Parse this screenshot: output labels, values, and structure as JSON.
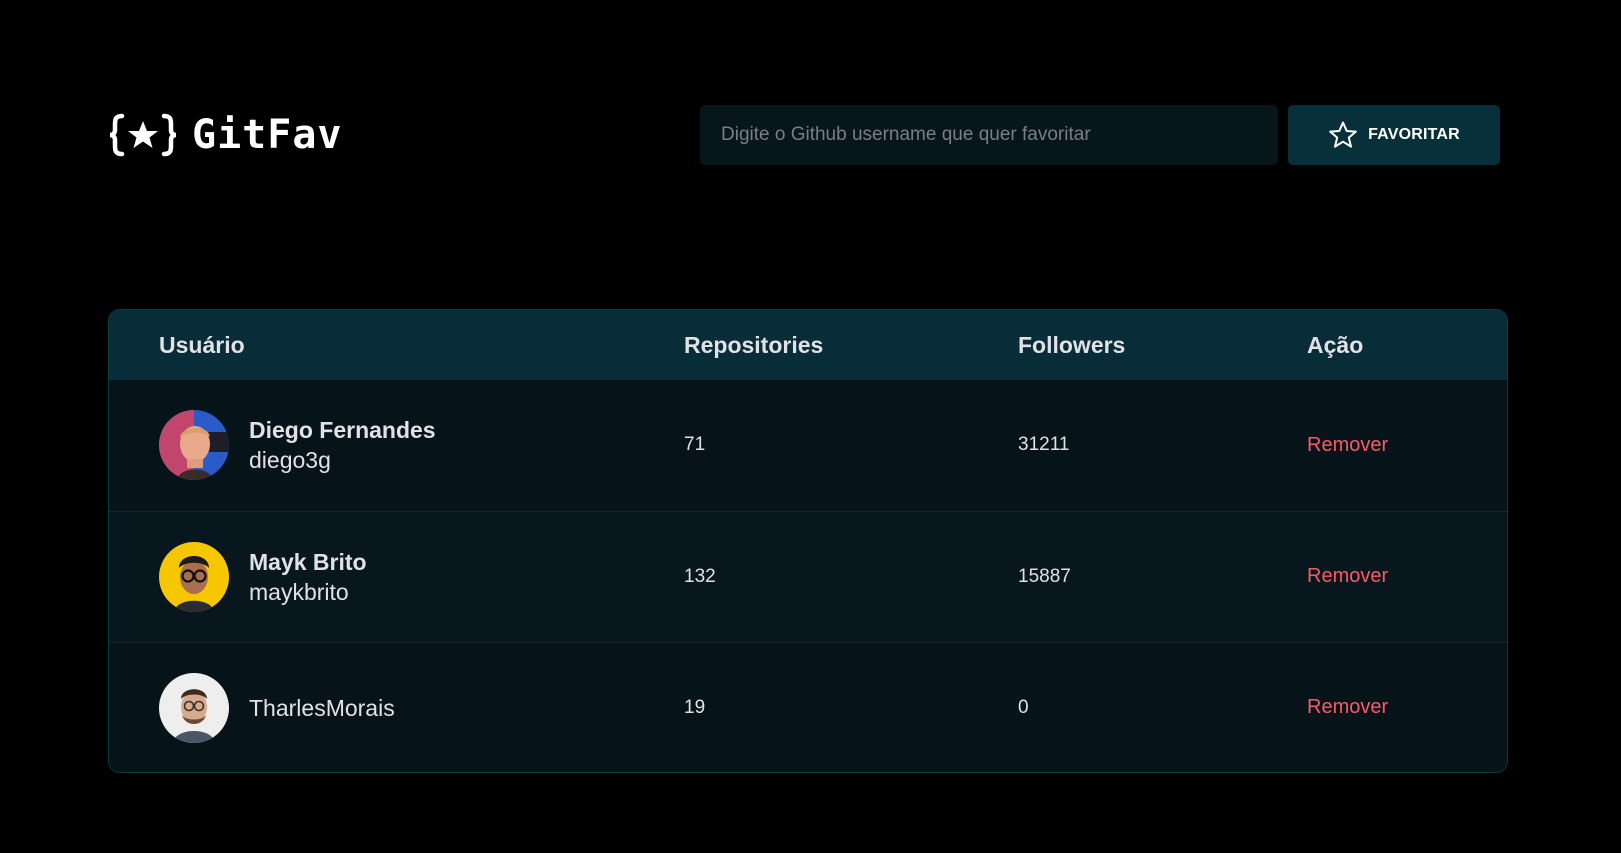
{
  "app": {
    "logo_text": "GitFav",
    "logo_icon": "braces-star-icon"
  },
  "search": {
    "placeholder": "Digite o Github username que quer favoritar",
    "value": "",
    "button_label": "FAVORITAR",
    "button_icon": "star-outline-icon"
  },
  "table": {
    "columns": {
      "user": "Usuário",
      "repositories": "Repositories",
      "followers": "Followers",
      "action": "Ação"
    },
    "rows": [
      {
        "name": "Diego Fernandes",
        "login": "diego3g",
        "repositories": "71",
        "followers": "31211",
        "action": "Remover"
      },
      {
        "name": "Mayk Brito",
        "login": "maykbrito",
        "repositories": "132",
        "followers": "15887",
        "action": "Remover"
      },
      {
        "name": "",
        "login": "TharlesMorais",
        "repositories": "19",
        "followers": "0",
        "action": "Remover"
      }
    ]
  },
  "colors": {
    "background": "#000000",
    "header_row": "#092D38",
    "button": "#08303B",
    "input": "#06161B",
    "remove": "#F75A68"
  }
}
